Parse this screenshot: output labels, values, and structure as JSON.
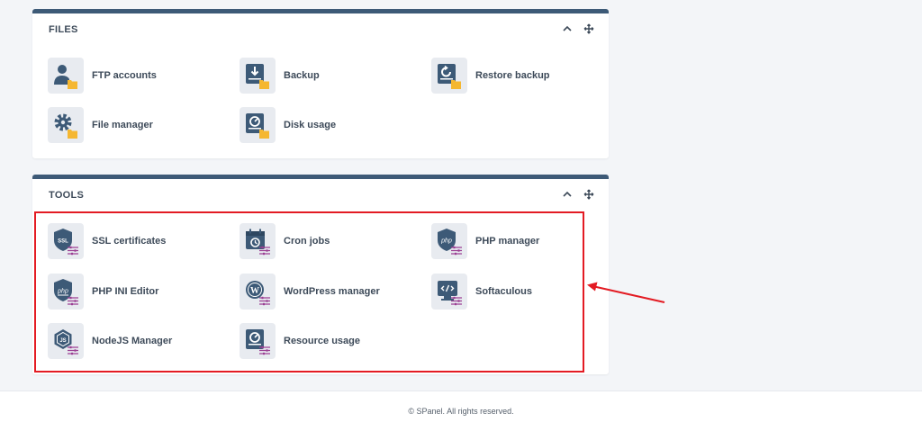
{
  "colors": {
    "panel_accent": "#3d5a77",
    "icon_dark": "#3d5a77",
    "folder": "#f5b731",
    "tool_bars": "#9b3f93",
    "highlight_annotation": "#e31b23"
  },
  "files": {
    "title": "FILES",
    "items": [
      {
        "label": "FTP accounts",
        "icon": "ftp-user-icon"
      },
      {
        "label": "Backup",
        "icon": "backup-drive-icon"
      },
      {
        "label": "Restore backup",
        "icon": "restore-drive-icon"
      },
      {
        "label": "File manager",
        "icon": "gear-folder-icon"
      },
      {
        "label": "Disk usage",
        "icon": "disk-gauge-icon"
      }
    ]
  },
  "tools": {
    "title": "TOOLS",
    "items": [
      {
        "label": "SSL certificates",
        "icon": "ssl-shield-icon"
      },
      {
        "label": "Cron jobs",
        "icon": "cron-calendar-icon"
      },
      {
        "label": "PHP manager",
        "icon": "php-shield-icon"
      },
      {
        "label": "PHP INI Editor",
        "icon": "php-ini-icon"
      },
      {
        "label": "WordPress manager",
        "icon": "wordpress-icon"
      },
      {
        "label": "Softaculous",
        "icon": "softaculous-code-icon"
      },
      {
        "label": "NodeJS Manager",
        "icon": "nodejs-icon"
      },
      {
        "label": "Resource usage",
        "icon": "resource-gauge-icon"
      }
    ]
  },
  "footer": {
    "text": "© SPanel. All rights reserved."
  }
}
